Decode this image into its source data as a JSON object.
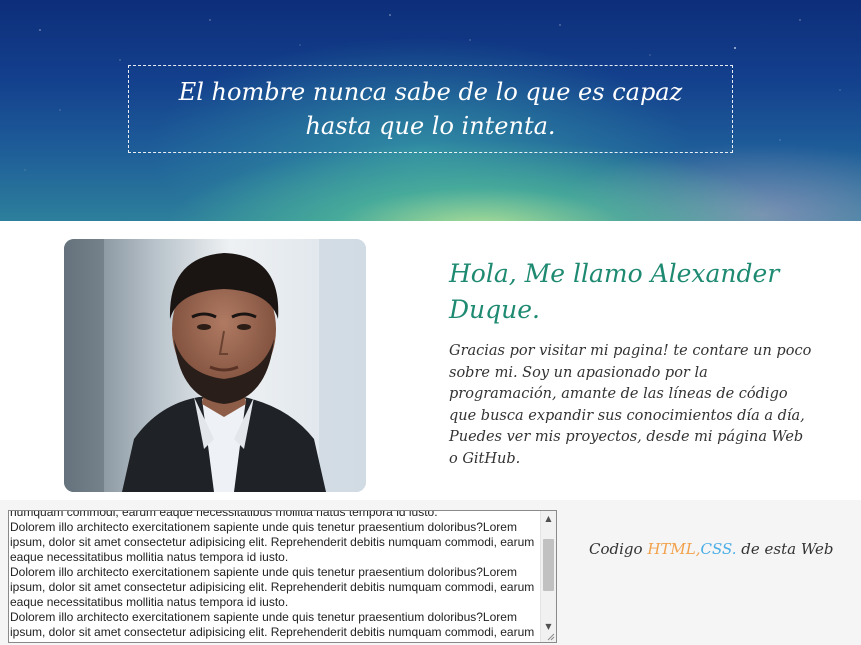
{
  "hero": {
    "quote": "El hombre nunca sabe de lo que es capaz hasta que lo intenta."
  },
  "about": {
    "title": "Hola, Me llamo Alexander Duque.",
    "text": "Gracias por visitar mi pagina! te contare un poco sobre mi. Soy un apasionado por la programación, amante de las líneas de código que busca expandir sus conocimientos día a día, Puedes ver mis proyectos, desde mi página Web o GitHub."
  },
  "code_box": {
    "value": "numquam commodi, earum eaque necessitatibus mollitia natus tempora id iusto.\nDolorem illo architecto exercitationem sapiente unde quis tenetur praesentium doloribus?Lorem ipsum, dolor sit amet consectetur adipisicing elit. Reprehenderit debitis numquam commodi, earum eaque necessitatibus mollitia natus tempora id iusto.\nDolorem illo architecto exercitationem sapiente unde quis tenetur praesentium doloribus?Lorem ipsum, dolor sit amet consectetur adipisicing elit. Reprehenderit debitis numquam commodi, earum eaque necessitatibus mollitia natus tempora id iusto.\nDolorem illo architecto exercitationem sapiente unde quis tenetur praesentium doloribus?Lorem ipsum, dolor sit amet consectetur adipisicing elit. Reprehenderit debitis numquam commodi, earum eaque necessitatibus mollitia natus tempora id iusto."
  },
  "footer": {
    "prefix": "Codigo ",
    "html_link": "HTML,",
    "css_link": "CSS.",
    "suffix": " de esta Web"
  },
  "colors": {
    "accent_title": "#1f8a72",
    "html_link": "#f2a14a",
    "css_link": "#4aaee6"
  },
  "icons": {
    "scroll_up": "chevron-up-icon",
    "scroll_down": "chevron-down-icon",
    "resize": "resize-grip-icon"
  }
}
